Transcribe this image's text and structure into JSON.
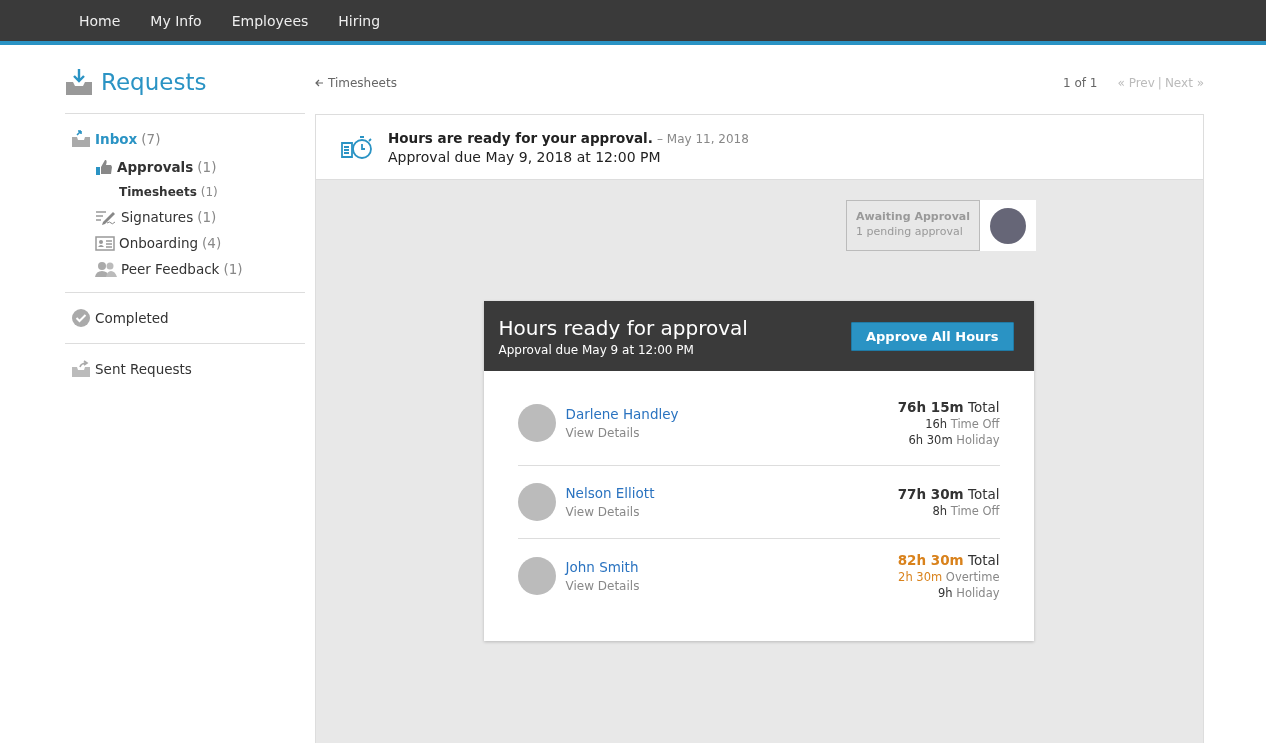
{
  "nav": [
    {
      "label": "Home",
      "selected": false
    },
    {
      "label": "My Info",
      "selected": false
    },
    {
      "label": "Employees",
      "selected": false
    },
    {
      "label": "Hiring",
      "selected": false
    }
  ],
  "page_title": "Requests",
  "breadcrumb": "Timesheets",
  "pager": {
    "count": "1 of 1",
    "prev": "« Prev",
    "separator": "|",
    "next": "Next »"
  },
  "sidebar": [
    {
      "label": "Inbox",
      "count": "(7)",
      "kind": "inbox",
      "expanded": true,
      "children": [
        {
          "label": "Approvals",
          "count": "(1)",
          "kind": "thumb",
          "selected": true,
          "children": [
            {
              "label": "Timesheets",
              "count": "(1)",
              "selected": true
            }
          ]
        },
        {
          "label": "Signatures",
          "count": "(1)",
          "kind": "pen",
          "selected": false
        },
        {
          "label": "Onboarding",
          "count": "(4)",
          "kind": "card",
          "selected": false
        },
        {
          "label": "Peer Feedback",
          "count": "(1)",
          "kind": "people",
          "selected": false
        }
      ]
    },
    {
      "label": "Completed",
      "kind": "check",
      "expanded": false
    },
    {
      "label": "Sent Requests",
      "kind": "sent",
      "expanded": false
    }
  ],
  "request": {
    "title": "Hours are ready for your approval.",
    "date": "– May 11, 2018",
    "due": "Approval due May 9, 2018 at 12:00 PM"
  },
  "status": {
    "title": "Awaiting Approval",
    "detail": "1 pending approval"
  },
  "card": {
    "title": "Hours ready for approval",
    "subtitle": "Approval due May 9 at 12:00 PM",
    "button": "Approve All Hours",
    "employees": [
      {
        "name": "Darlene Handley",
        "link": "View Details",
        "hours": [
          {
            "amount": "76h 15m",
            "label": "Total",
            "kind": "total",
            "alert": false
          },
          {
            "amount": "16h",
            "label": "Time Off",
            "kind": "detail",
            "alert": false
          },
          {
            "amount": "6h 30m",
            "label": "Holiday",
            "kind": "detail",
            "alert": false
          }
        ]
      },
      {
        "name": "Nelson Elliott",
        "link": "View Details",
        "hours": [
          {
            "amount": "77h 30m",
            "label": "Total",
            "kind": "total",
            "alert": false
          },
          {
            "amount": "8h",
            "label": "Time Off",
            "kind": "detail",
            "alert": false
          }
        ]
      },
      {
        "name": "John Smith",
        "link": "View Details",
        "hours": [
          {
            "amount": "82h 30m",
            "label": "Total",
            "kind": "total",
            "alert": true
          },
          {
            "amount": "2h 30m",
            "label": "Overtime",
            "kind": "detail",
            "alert": true
          },
          {
            "amount": "9h",
            "label": "Holiday",
            "kind": "detail",
            "alert": false
          }
        ]
      }
    ]
  }
}
